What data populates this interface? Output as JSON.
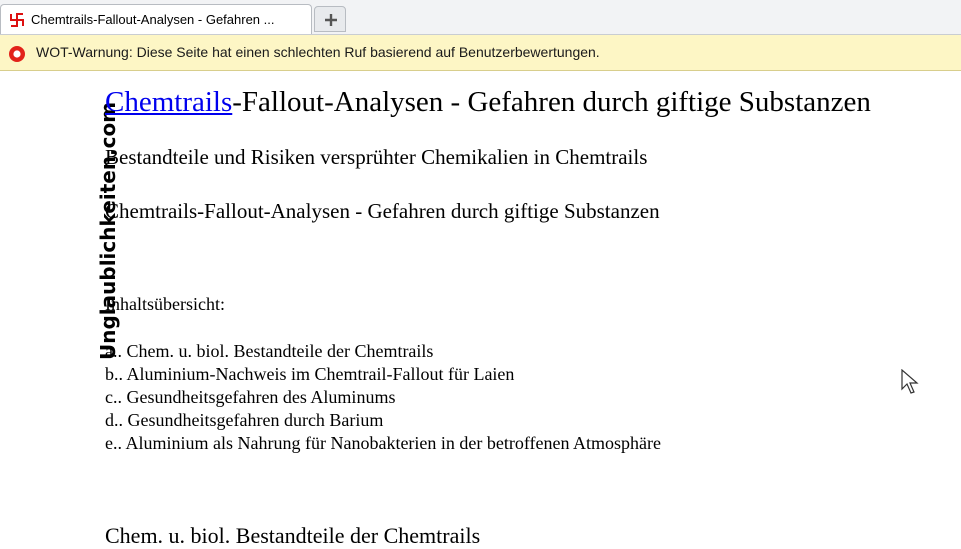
{
  "browser": {
    "tab_title": "Chemtrails-Fallout-Analysen - Gefahren ...",
    "new_tab_label": "+",
    "favicon": "swastika-favicon-icon"
  },
  "notification": {
    "text": "WOT-Warnung: Diese Seite hat einen schlechten Ruf basierend auf Benutzerbewertungen.",
    "icon": "wot-warning-icon",
    "color": "#fdf6c5"
  },
  "page": {
    "brand": "Unglaublichkeiten.com",
    "title_link": "Chemtrails",
    "title_rest": "-Fallout-Analysen - Gefahren durch giftige Substanzen",
    "subtitle1": "Bestandteile und Risiken versprühter Chemikalien in Chemtrails",
    "subtitle2": "Chemtrails-Fallout-Analysen - Gefahren durch giftige Substanzen",
    "toc_label": "Inhaltsübersicht:",
    "toc": [
      "a.. Chem. u. biol. Bestandteile der Chemtrails",
      "b.. Aluminium-Nachweis im Chemtrail-Fallout für Laien",
      "c.. Gesundheitsgefahren des Aluminums",
      "d.. Gesundheitsgefahren durch Barium",
      "e.. Aluminium als Nahrung für Nanobakterien in der betroffenen Atmosphäre"
    ],
    "section_heading": "Chem. u. biol. Bestandteile der Chemtrails",
    "link_color": "#0000ee"
  }
}
